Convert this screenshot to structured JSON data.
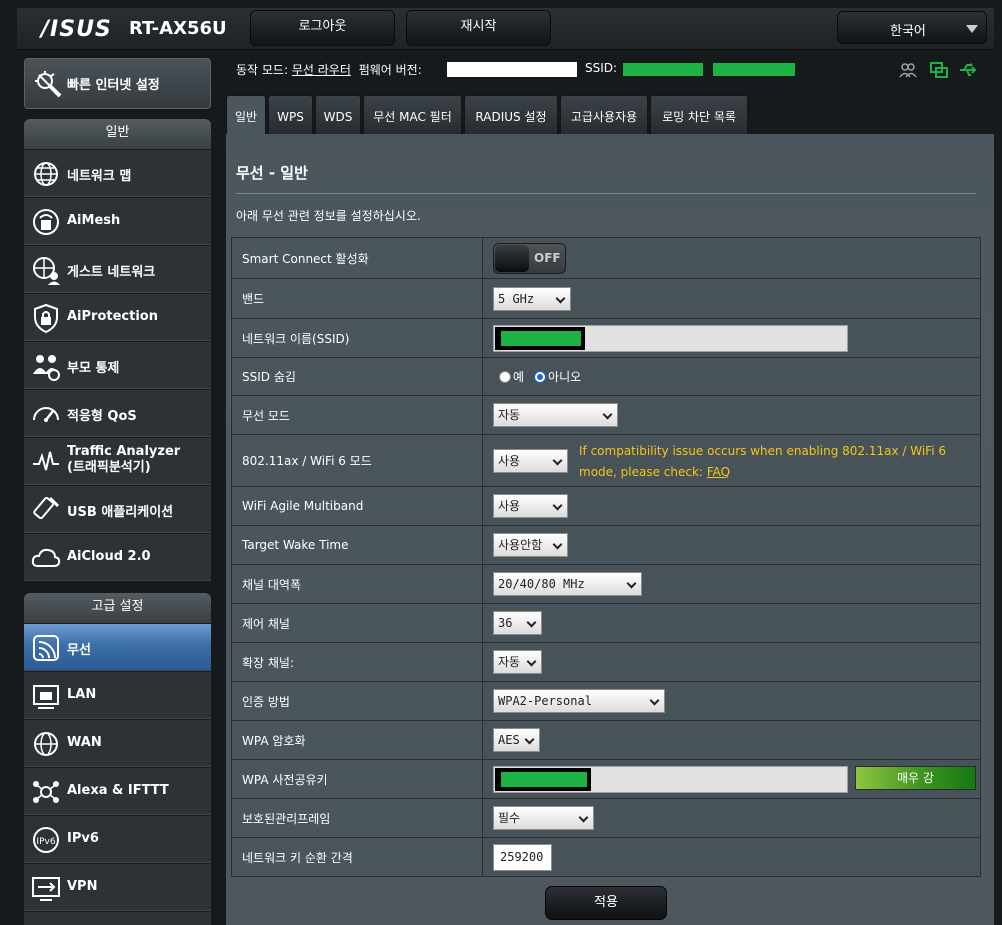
{
  "header": {
    "logo": "/ISUS",
    "model": "RT-AX56U",
    "logout_label": "로그아웃",
    "reboot_label": "재시작",
    "language": "한국어"
  },
  "status": {
    "mode_label": "동작 모드:",
    "mode_value": "무선 라우터",
    "firmware_label": "펌웨어 버전:",
    "ssid_label": "SSID:"
  },
  "sidebar": {
    "quick_setup": "빠른 인터넷 설정",
    "general_title": "일반",
    "general_items": [
      {
        "label": "네트워크 맵"
      },
      {
        "label": "AiMesh"
      },
      {
        "label": "게스트 네트워크"
      },
      {
        "label": "AiProtection"
      },
      {
        "label": "부모 통제"
      },
      {
        "label": "적응형 QoS"
      },
      {
        "label": "Traffic Analyzer",
        "label2": "(트래픽분석기)"
      },
      {
        "label": "USB 애플리케이션"
      },
      {
        "label": "AiCloud 2.0"
      }
    ],
    "advanced_title": "고급 설정",
    "advanced_items": [
      {
        "label": "무선"
      },
      {
        "label": "LAN"
      },
      {
        "label": "WAN"
      },
      {
        "label": "Alexa & IFTTT"
      },
      {
        "label": "IPv6"
      },
      {
        "label": "VPN"
      }
    ]
  },
  "tabs": [
    {
      "label": "일반"
    },
    {
      "label": "WPS"
    },
    {
      "label": "WDS"
    },
    {
      "label": "무선 MAC 필터"
    },
    {
      "label": "RADIUS 설정"
    },
    {
      "label": "고급사용자용"
    },
    {
      "label": "로밍 차단 목록"
    }
  ],
  "panel": {
    "title": "무선 - 일반",
    "description": "아래 무선 관련 정보를 설정하십시오."
  },
  "form": {
    "smart_connect_label": "Smart Connect 활성화",
    "smart_connect_value": "OFF",
    "band_label": "밴드",
    "band_value": "5 GHz",
    "ssid_label": "네트워크 이름(SSID)",
    "hide_ssid_label": "SSID 숨김",
    "hide_ssid_yes": "예",
    "hide_ssid_no": "아니오",
    "hide_ssid_selected": "아니오",
    "wireless_mode_label": "무선 모드",
    "wireless_mode_value": "자동",
    "ax_mode_label": "802.11ax / WiFi 6 모드",
    "ax_mode_value": "사용",
    "ax_warning": "If compatibility issue occurs when enabling 802.11ax / WiFi 6 mode, please check:",
    "ax_faq": "FAQ",
    "agile_label": "WiFi Agile Multiband",
    "agile_value": "사용",
    "twt_label": "Target Wake Time",
    "twt_value": "사용안함",
    "bandwidth_label": "채널 대역폭",
    "bandwidth_value": "20/40/80 MHz",
    "control_channel_label": "제어 채널",
    "control_channel_value": "36",
    "ext_channel_label": "확장 채널:",
    "ext_channel_value": "자동",
    "auth_label": "인증 방법",
    "auth_value": "WPA2-Personal",
    "encryption_label": "WPA 암호화",
    "encryption_value": "AES",
    "psk_label": "WPA 사전공유키",
    "psk_strength": "매우 강",
    "pmf_label": "보호된관리프레임",
    "pmf_value": "필수",
    "rotation_label": "네트워크 키 순환 간격",
    "rotation_value": "259200"
  },
  "apply_label": "적용",
  "colors": {
    "accent_green": "#1db344",
    "warning_yellow": "#f5c518",
    "active_nav_blue": "#3d6fa8",
    "panel_gray": "#4b555c"
  }
}
